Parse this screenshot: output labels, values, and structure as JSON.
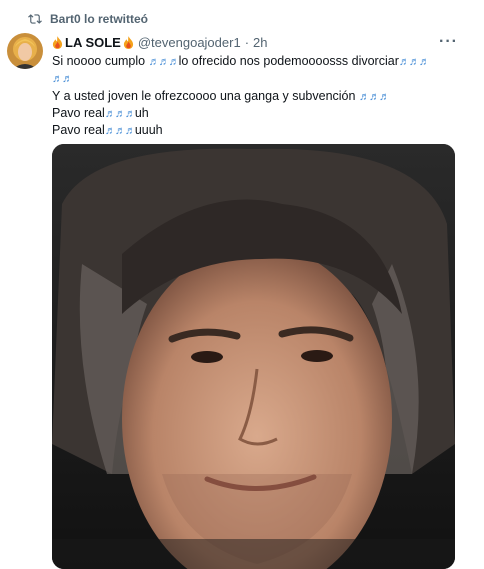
{
  "retweet": {
    "text": "Bart0 lo retwitteó",
    "icon": "retweet-icon",
    "color": "#536471"
  },
  "tweet": {
    "author": {
      "display_name": "LA SOLE",
      "handle": "@tevengoajoder1",
      "separator": "·",
      "time": "2h",
      "name_emoji": "fire-icon"
    },
    "more_label": "···",
    "lines": [
      {
        "before": "Si noooo cumplo ",
        "notes1": "♬♬♬",
        "middle": "lo ofrecido nos podemoooosss divorciar",
        "notes2": "♬♬♬",
        "after": ""
      },
      {
        "before": "",
        "notes1": "♬♬",
        "middle": "",
        "notes2": "",
        "after": ""
      },
      {
        "before": "Y a usted joven le ofrezcoooo una ganga y subvención ",
        "notes1": "♬♬♬",
        "middle": "",
        "notes2": "",
        "after": ""
      },
      {
        "before": "Pavo real",
        "notes1": "♬♬♬",
        "middle": "uh",
        "notes2": "",
        "after": ""
      },
      {
        "before": "Pavo real",
        "notes1": "♬♬♬",
        "middle": "uuuh",
        "notes2": "",
        "after": ""
      }
    ],
    "media_alt": "meme face photo",
    "text_color": "#0f1419",
    "note_color": "#4a8fd6"
  }
}
